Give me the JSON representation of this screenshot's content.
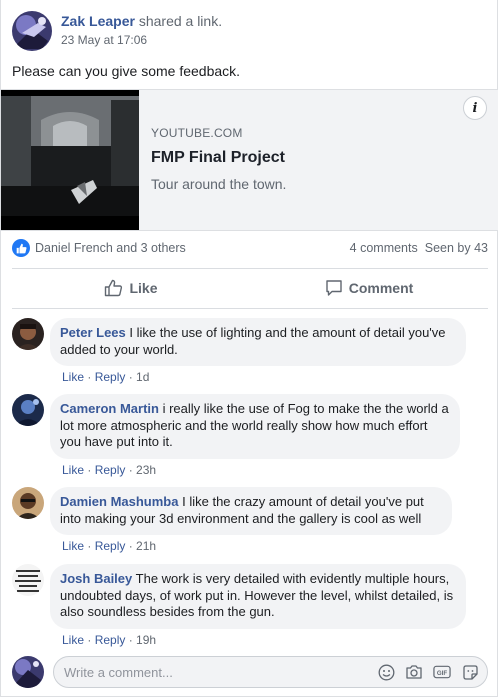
{
  "post": {
    "author": "Zak Leaper",
    "action": "shared a link.",
    "timestamp": "23 May at 17:06",
    "text": "Please can you give some feedback."
  },
  "link": {
    "domain": "YOUTUBE.COM",
    "title": "FMP Final Project",
    "description": "Tour around the town.",
    "info_glyph": "i"
  },
  "reactions": {
    "reactors": "Daniel French and 3 others",
    "comments": "4 comments",
    "seen": "Seen by 43"
  },
  "actions": {
    "like": "Like",
    "comment": "Comment"
  },
  "comments": [
    {
      "name": "Peter Lees",
      "text": "I like the use of lighting and the amount of detail you've added to your world.",
      "like": "Like",
      "reply": "Reply",
      "time": "1d"
    },
    {
      "name": "Cameron Martin",
      "text": "i really like the use of Fog to make the the world a lot more atmospheric and the world really show how much effort you have put into it.",
      "like": "Like",
      "reply": "Reply",
      "time": "23h"
    },
    {
      "name": "Damien Mashumba",
      "text": "I like the crazy amount of detail you've put into making your 3d environment and the gallery is cool as well",
      "like": "Like",
      "reply": "Reply",
      "time": "21h"
    },
    {
      "name": "Josh Bailey",
      "text": "The work is very detailed with evidently multiple hours, undoubted days, of work put in. However the level, whilst detailed, is also soundless besides from the gun.",
      "like": "Like",
      "reply": "Reply",
      "time": "19h"
    }
  ],
  "composer": {
    "placeholder": "Write a comment...",
    "gif_label": "GIF"
  },
  "colors": {
    "link_blue": "#385898",
    "like_blue": "#2078f4",
    "muted": "#606770",
    "bubble": "#f2f3f5"
  }
}
